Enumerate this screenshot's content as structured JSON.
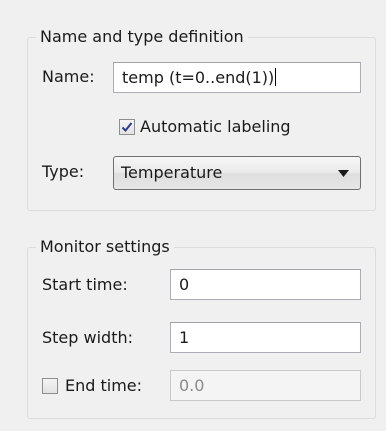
{
  "name_group": {
    "legend": "Name and type definition",
    "name_label": "Name:",
    "name_value": "temp (t=0..end(1))",
    "auto_label_text": "Automatic labeling",
    "auto_label_checked": true,
    "type_label": "Type:",
    "type_value": "Temperature"
  },
  "monitor_group": {
    "legend": "Monitor settings",
    "start_label": "Start time:",
    "start_value": "0",
    "step_label": "Step width:",
    "step_value": "1",
    "end_label": "End time:",
    "end_checked": false,
    "end_value": "0.0"
  },
  "icons": {
    "checkmark": "check-icon",
    "dropdown": "chevron-down-icon"
  }
}
